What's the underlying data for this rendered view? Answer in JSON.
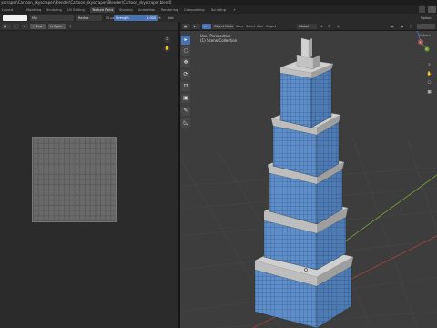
{
  "window": {
    "title": "yscraper\\Cartoon_skyscraper\\Blender\\Cartoon_skyscraper\\Blender\\Cartoon_skyscraper.blend]"
  },
  "workspaces": {
    "tabs": [
      "Layout",
      "Modeling",
      "Sculpting",
      "UV Editing",
      "Texture Paint",
      "Shading",
      "Animation",
      "Rendering",
      "Compositing",
      "Scripting"
    ],
    "active": "Texture Paint",
    "add": "+"
  },
  "tool_header": {
    "mode": "Mix",
    "radius_label": "Radius",
    "radius_value": "50 px",
    "strength_label": "Strength",
    "strength_value": "1.000",
    "add_label": "Add",
    "options_label": "Options"
  },
  "image_editor": {
    "new_label": "New",
    "open_label": "Open"
  },
  "viewport": {
    "mode_label": "Object Mode",
    "menu": [
      "View",
      "Select",
      "Add",
      "Object"
    ],
    "transform": "Global",
    "overlay_title": "User Perspective",
    "overlay_collection": "(1) Scene Collection",
    "gizmo_axes": [
      "X",
      "Y",
      "Z"
    ]
  },
  "colors": {
    "accent": "#4772b3",
    "grid_line": "#4a4a4a",
    "axis_x": "#a0413f",
    "axis_y": "#79a13a",
    "glass": "#5e8ec9",
    "concrete": "#c9c9c9"
  }
}
